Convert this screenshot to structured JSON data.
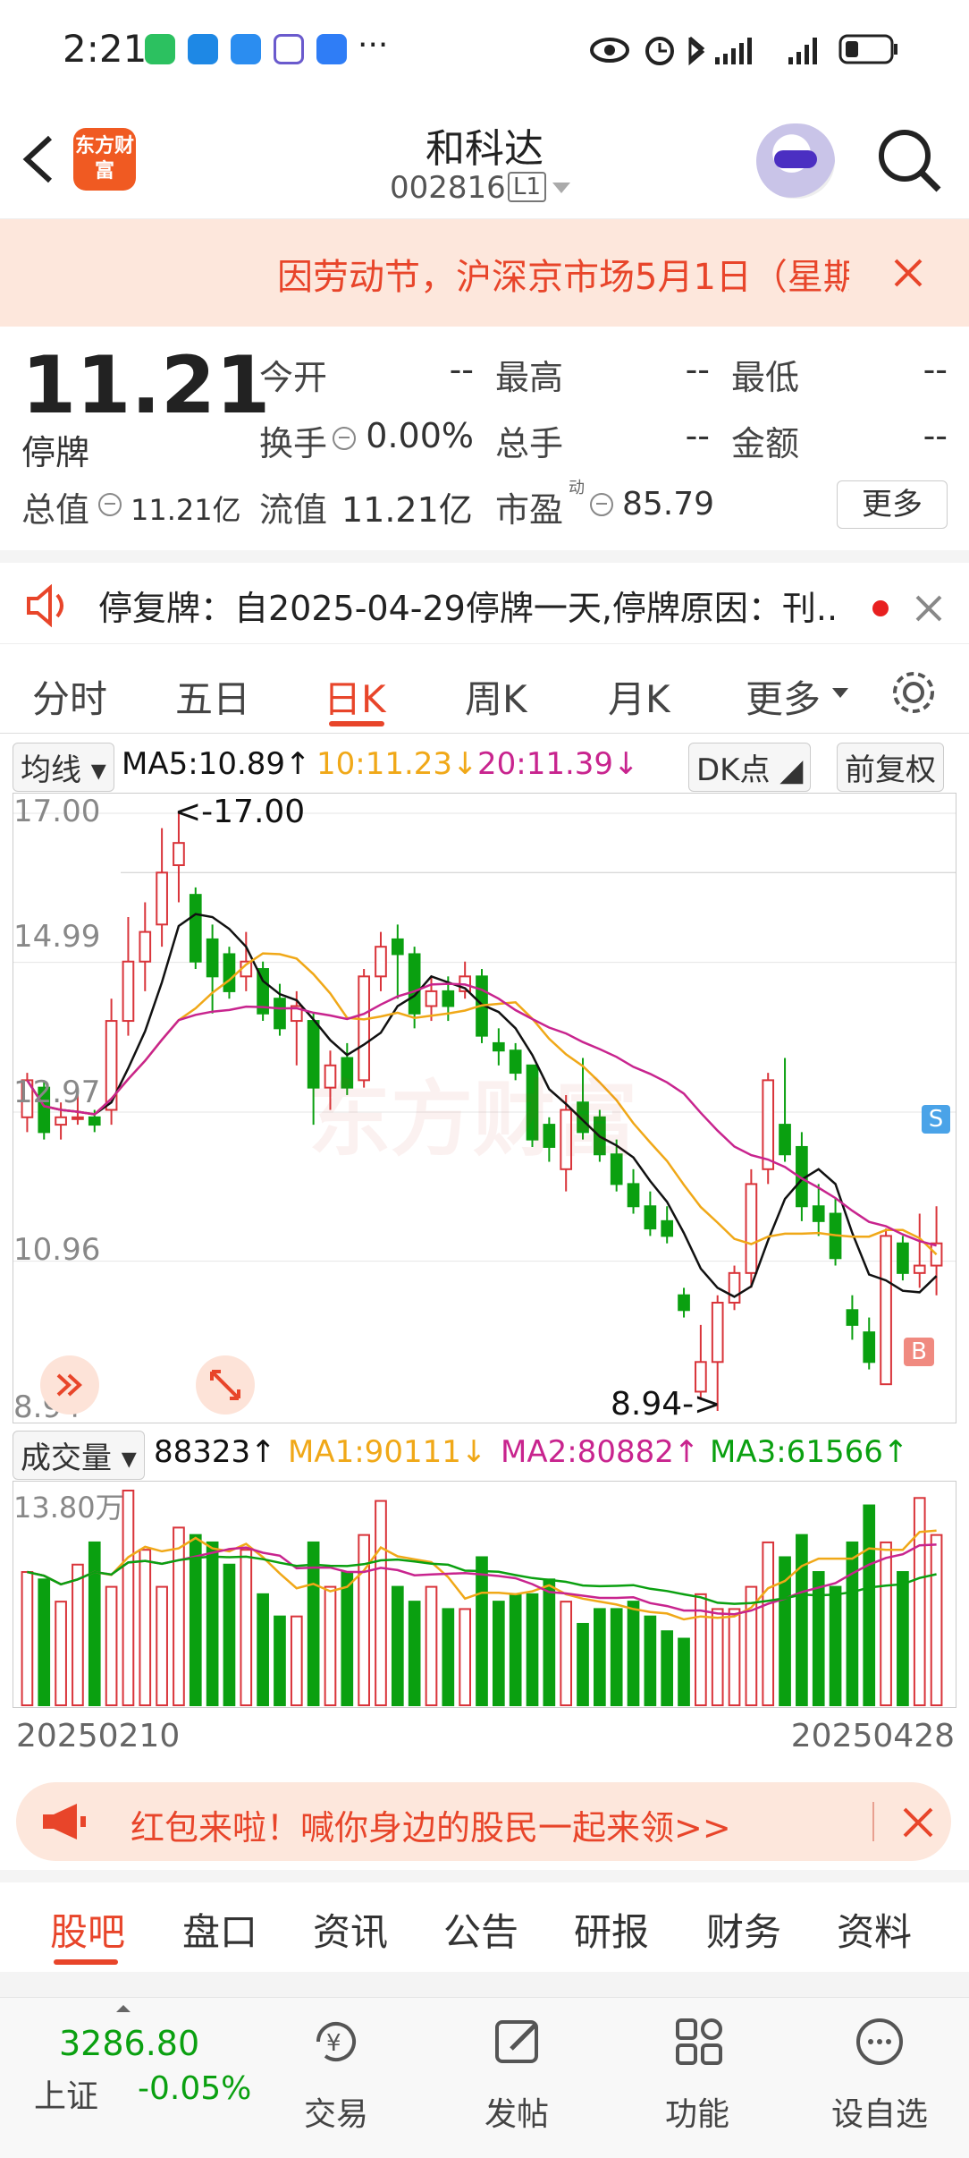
{
  "status_bar": {
    "time": "2:21",
    "more": "···"
  },
  "header": {
    "title": "和科达",
    "code": "002816",
    "level": "L1",
    "logo_text": "东方财富"
  },
  "notice": {
    "text": "因劳动节，沪深京市场5月1日（星期"
  },
  "quote": {
    "price": "11.21",
    "status": "停牌",
    "open_label": "今开",
    "open_val": "--",
    "high_label": "最高",
    "high_val": "--",
    "low_label": "最低",
    "low_val": "--",
    "turnover_label": "换手",
    "turnover_val": "0.00%",
    "vol_label": "总手",
    "vol_val": "--",
    "amount_label": "金额",
    "amount_val": "--",
    "cap_label": "总值",
    "cap_val": "11.21亿",
    "float_label": "流值",
    "float_val": "11.21亿",
    "pe_label": "市盈",
    "pe_sup": "动",
    "pe_val": "85.79",
    "more_button": "更多"
  },
  "halt_notice": {
    "text": "停复牌：自2025-04-29停牌一天,停牌原因：刊..."
  },
  "chart_tabs": [
    "分时",
    "五日",
    "日K",
    "周K",
    "月K",
    "更多"
  ],
  "active_tab": "日K",
  "ma_bar": {
    "indicator": "均线",
    "ma5": "MA5:10.89",
    "ma5_arrow": "↑",
    "ma10": "10:11.23",
    "ma10_arrow": "↓",
    "ma20": "20:11.39",
    "ma20_arrow": "↓",
    "dk": "DK点",
    "adjust": "前复权"
  },
  "price_axis": [
    "17.00",
    "14.99",
    "12.97",
    "10.96",
    "8.94"
  ],
  "annotations": {
    "high": "<-17.00",
    "low": "8.94->",
    "sell_marker": "S",
    "buy_marker": "B",
    "watermark": "东方财富"
  },
  "vol_bar": {
    "indicator": "成交量",
    "vol": "88323",
    "vol_arrow": "↑",
    "ma1": "MA1:90111",
    "ma1_arrow": "↓",
    "ma2": "MA2:80882",
    "ma2_arrow": "↑",
    "ma3": "MA3:61566",
    "ma3_arrow": "↑",
    "max_label": "13.80万"
  },
  "date_range": {
    "start": "20250210",
    "end": "20250428"
  },
  "banner": {
    "text": "红包来啦！喊你身边的股民一起来领>>"
  },
  "sub_tabs": [
    "股吧",
    "盘口",
    "资讯",
    "公告",
    "研报",
    "财务",
    "资料"
  ],
  "active_sub_tab": "股吧",
  "bottom_bar": {
    "index_value": "3286.80",
    "index_name": "上证",
    "index_change": "-0.05%",
    "items": [
      "交易",
      "发帖",
      "功能",
      "设自选"
    ]
  },
  "colors": {
    "up": "#d9343a",
    "down": "#0aa010",
    "ma5": "#111111",
    "ma10": "#f0a818",
    "ma20": "#c8248e",
    "accent": "#e8452a"
  },
  "chart_data": {
    "type": "candlestick",
    "ylim": [
      8.94,
      17.0
    ],
    "candles": [
      [
        12.9,
        13.5,
        12.7,
        13.4
      ],
      [
        13.3,
        13.4,
        12.6,
        12.7
      ],
      [
        12.8,
        13.1,
        12.6,
        12.9
      ],
      [
        12.9,
        13.3,
        12.8,
        12.9
      ],
      [
        12.9,
        13.0,
        12.7,
        12.8
      ],
      [
        13.0,
        14.5,
        12.8,
        14.2
      ],
      [
        14.2,
        15.6,
        14.0,
        15.0
      ],
      [
        15.0,
        15.8,
        14.6,
        15.4
      ],
      [
        15.5,
        16.8,
        15.2,
        16.2
      ],
      [
        16.3,
        17.0,
        15.8,
        16.6
      ],
      [
        15.9,
        16.0,
        14.9,
        15.0
      ],
      [
        15.3,
        15.5,
        14.3,
        14.8
      ],
      [
        15.1,
        15.2,
        14.5,
        14.6
      ],
      [
        14.8,
        15.4,
        14.6,
        15.0
      ],
      [
        14.9,
        15.0,
        14.2,
        14.3
      ],
      [
        14.5,
        14.7,
        14.0,
        14.1
      ],
      [
        14.2,
        14.6,
        13.6,
        14.4
      ],
      [
        14.2,
        14.3,
        12.8,
        13.3
      ],
      [
        13.3,
        13.8,
        13.0,
        13.6
      ],
      [
        13.7,
        13.9,
        13.2,
        13.3
      ],
      [
        13.4,
        14.9,
        13.3,
        14.8
      ],
      [
        14.8,
        15.4,
        14.6,
        15.2
      ],
      [
        15.3,
        15.5,
        14.5,
        15.1
      ],
      [
        15.1,
        15.2,
        14.1,
        14.3
      ],
      [
        14.4,
        14.8,
        14.2,
        14.6
      ],
      [
        14.6,
        14.8,
        14.2,
        14.4
      ],
      [
        14.6,
        15.0,
        14.5,
        14.8
      ],
      [
        14.8,
        14.9,
        13.9,
        14.0
      ],
      [
        13.9,
        14.1,
        13.6,
        13.8
      ],
      [
        13.8,
        13.9,
        13.4,
        13.5
      ],
      [
        13.6,
        13.6,
        12.5,
        12.6
      ],
      [
        12.8,
        12.9,
        12.3,
        12.5
      ],
      [
        12.2,
        13.2,
        11.9,
        13.0
      ],
      [
        13.1,
        13.7,
        12.6,
        12.7
      ],
      [
        12.9,
        13.0,
        12.3,
        12.4
      ],
      [
        12.4,
        12.6,
        11.9,
        12.0
      ],
      [
        12.0,
        12.2,
        11.6,
        11.7
      ],
      [
        11.7,
        11.9,
        11.3,
        11.4
      ],
      [
        11.5,
        11.7,
        11.2,
        11.3
      ],
      [
        10.5,
        10.6,
        10.2,
        10.3
      ],
      [
        9.2,
        10.1,
        9.1,
        9.6
      ],
      [
        9.6,
        10.5,
        8.94,
        10.4
      ],
      [
        10.4,
        10.9,
        10.3,
        10.8
      ],
      [
        10.8,
        12.2,
        10.6,
        12.0
      ],
      [
        12.2,
        13.5,
        12.0,
        13.4
      ],
      [
        12.8,
        13.7,
        12.3,
        12.4
      ],
      [
        12.5,
        12.7,
        11.5,
        11.7
      ],
      [
        11.7,
        12.0,
        11.3,
        11.5
      ],
      [
        11.6,
        11.8,
        10.9,
        11.0
      ],
      [
        10.3,
        10.5,
        9.9,
        10.1
      ],
      [
        10.0,
        10.2,
        9.5,
        9.6
      ],
      [
        9.3,
        11.4,
        9.3,
        11.3
      ],
      [
        11.2,
        11.3,
        10.7,
        10.8
      ],
      [
        10.8,
        11.6,
        10.6,
        10.9
      ],
      [
        10.9,
        11.7,
        10.5,
        11.2
      ]
    ],
    "volume": [
      9.0,
      8.5,
      7.0,
      9.5,
      11.0,
      8.0,
      14.5,
      10.5,
      8.0,
      12.0,
      11.5,
      11.0,
      9.5,
      10.5,
      7.5,
      6.0,
      6.0,
      11.0,
      8.0,
      9.0,
      11.5,
      13.8,
      8.0,
      7.0,
      8.0,
      6.5,
      6.5,
      10.0,
      7.0,
      7.5,
      7.5,
      8.5,
      7.0,
      5.5,
      6.5,
      6.5,
      7.0,
      6.0,
      5.0,
      4.5,
      7.5,
      6.5,
      6.5,
      8.0,
      11.0,
      10.0,
      11.5,
      9.0,
      8.0,
      11.0,
      13.5,
      11.0,
      9.0,
      14.0,
      11.5
    ]
  }
}
